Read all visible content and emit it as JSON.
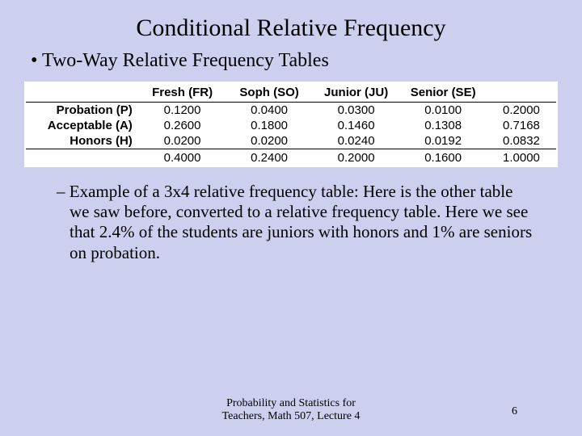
{
  "title": "Conditional Relative Frequency",
  "bullet": "Two-Way Relative Frequency Tables",
  "table": {
    "columns": [
      "Fresh (FR)",
      "Soph (SO)",
      "Junior (JU)",
      "Senior (SE)"
    ],
    "rows": [
      {
        "label": "Probation (P)",
        "cells": [
          "0.1200",
          "0.0400",
          "0.0300",
          "0.0100"
        ],
        "total": "0.2000"
      },
      {
        "label": "Acceptable (A)",
        "cells": [
          "0.2600",
          "0.1800",
          "0.1460",
          "0.1308"
        ],
        "total": "0.7168"
      },
      {
        "label": "Honors (H)",
        "cells": [
          "0.0200",
          "0.0200",
          "0.0240",
          "0.0192"
        ],
        "total": "0.0832"
      }
    ],
    "col_totals": [
      "0.4000",
      "0.2400",
      "0.2000",
      "0.1600"
    ],
    "grand_total": "1.0000"
  },
  "example_prefix": "– ",
  "example": "Example of a 3x4 relative frequency table: Here is the other table we saw before, converted to a relative frequency table. Here we see that 2.4% of the students are juniors with honors and 1% are seniors on probation.",
  "footer_line1": "Probability and Statistics for",
  "footer_line2": "Teachers, Math 507, Lecture 4",
  "page_number": "6"
}
